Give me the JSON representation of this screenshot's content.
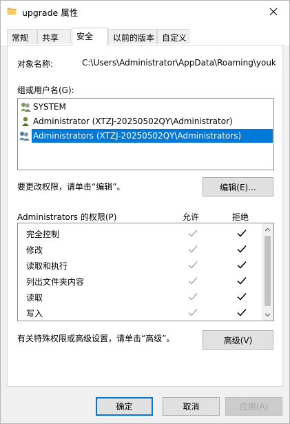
{
  "window": {
    "title": "upgrade 属性",
    "close_label": "✕"
  },
  "tabs": [
    {
      "label": "常规",
      "active": false
    },
    {
      "label": "共享",
      "active": false
    },
    {
      "label": "安全",
      "active": true
    },
    {
      "label": "以前的版本",
      "active": false
    },
    {
      "label": "自定义",
      "active": false
    }
  ],
  "security": {
    "object_name_label": "对象名称:",
    "object_name_value": "C:\\Users\\Administrator\\AppData\\Roaming\\youk",
    "groups_label": "组或用户名(G):",
    "principals": [
      {
        "name": "SYSTEM",
        "icon": "users-group-icon",
        "selected": false
      },
      {
        "name": "Administrator (XTZJ-20250502QY\\Administrator)",
        "icon": "user-icon",
        "selected": false
      },
      {
        "name": "Administrators (XTZJ-20250502QY\\Administrators)",
        "icon": "users-group-icon",
        "selected": true
      }
    ],
    "edit_hint": "要更改权限，请单击“编辑”。",
    "edit_button": "编辑(E)...",
    "permissions_label": "Administrators 的权限(P)",
    "allow_header": "允许",
    "deny_header": "拒绝",
    "permissions": [
      {
        "name": "完全控制",
        "allow": "inherited",
        "deny": "checked"
      },
      {
        "name": "修改",
        "allow": "inherited",
        "deny": "checked"
      },
      {
        "name": "读取和执行",
        "allow": "inherited",
        "deny": "checked"
      },
      {
        "name": "列出文件夹内容",
        "allow": "inherited",
        "deny": "checked"
      },
      {
        "name": "读取",
        "allow": "inherited",
        "deny": "checked"
      },
      {
        "name": "写入",
        "allow": "inherited",
        "deny": "checked"
      }
    ],
    "advanced_hint": "有关特殊权限或高级设置，请单击“高级”。",
    "advanced_button": "高级(V)"
  },
  "footer": {
    "ok": "确定",
    "cancel": "取消",
    "apply": "应用(A)"
  },
  "colors": {
    "accent": "#0078d7",
    "checked": "#000000",
    "inherited_check": "#a6a6a6"
  }
}
